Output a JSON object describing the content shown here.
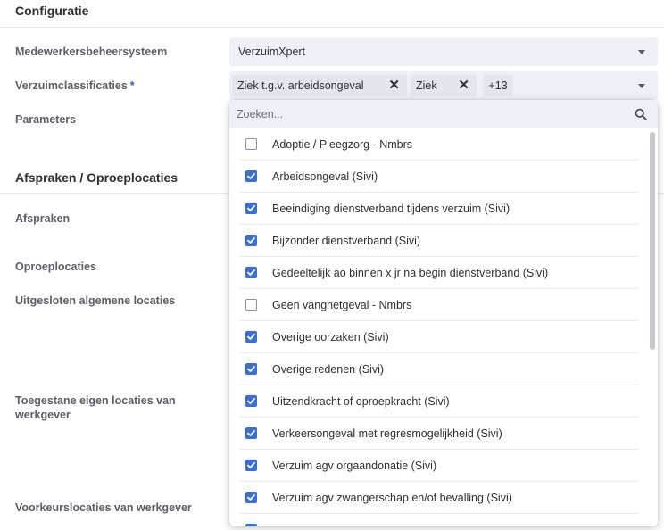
{
  "sections": {
    "configuratie": "Configuratie",
    "afspraken": "Afspraken / Oproeplocaties"
  },
  "labels": {
    "medewerkers": "Medewerkersbeheersysteem",
    "verzuim": "Verzuimclassificaties",
    "required_marker": "*",
    "parameters": "Parameters",
    "afspraken": "Afspraken",
    "oproeplocaties": "Oproeplocaties",
    "uitgesloten": "Uitgesloten algemene locaties",
    "toegestane": "Toegestane eigen locaties van werkgever",
    "voorkeur": "Voorkeurslocaties van werkgever"
  },
  "medewerkers_select": {
    "value": "VerzuimXpert"
  },
  "verzuim_select": {
    "chips": [
      "Ziek t.g.v. arbeidsongeval",
      "Ziek"
    ],
    "chip_remove_glyph": "✕",
    "more": "+13"
  },
  "dropdown": {
    "search_placeholder": "Zoeken...",
    "options": [
      {
        "label": "Adoptie / Pleegzorg - Nmbrs",
        "checked": false
      },
      {
        "label": "Arbeidsongeval (Sivi)",
        "checked": true
      },
      {
        "label": "Beeindiging dienstverband tijdens verzuim (Sivi)",
        "checked": true
      },
      {
        "label": "Bijzonder dienstverband (Sivi)",
        "checked": true
      },
      {
        "label": "Gedeeltelijk ao binnen x jr na begin dienstverband (Sivi)",
        "checked": true
      },
      {
        "label": "Geen vangnetgeval - Nmbrs",
        "checked": false
      },
      {
        "label": "Overige oorzaken (Sivi)",
        "checked": true
      },
      {
        "label": "Overige redenen (Sivi)",
        "checked": true
      },
      {
        "label": "Uitzendkracht of oproepkracht (Sivi)",
        "checked": true
      },
      {
        "label": "Verkeersongeval met regresmogelijkheid (Sivi)",
        "checked": true
      },
      {
        "label": "Verzuim agv orgaandonatie (Sivi)",
        "checked": true
      },
      {
        "label": "Verzuim agv zwangerschap en/of bevalling (Sivi)",
        "checked": true
      },
      {
        "label": "",
        "checked": true
      }
    ]
  },
  "colors": {
    "accent": "#3b6fd8",
    "field_bg": "#eef0f7",
    "chip_bg": "#e3e6ef"
  },
  "icons": {
    "search": "search-icon",
    "caret": "chevron-down-icon",
    "remove": "close-icon",
    "check": "check-icon"
  }
}
